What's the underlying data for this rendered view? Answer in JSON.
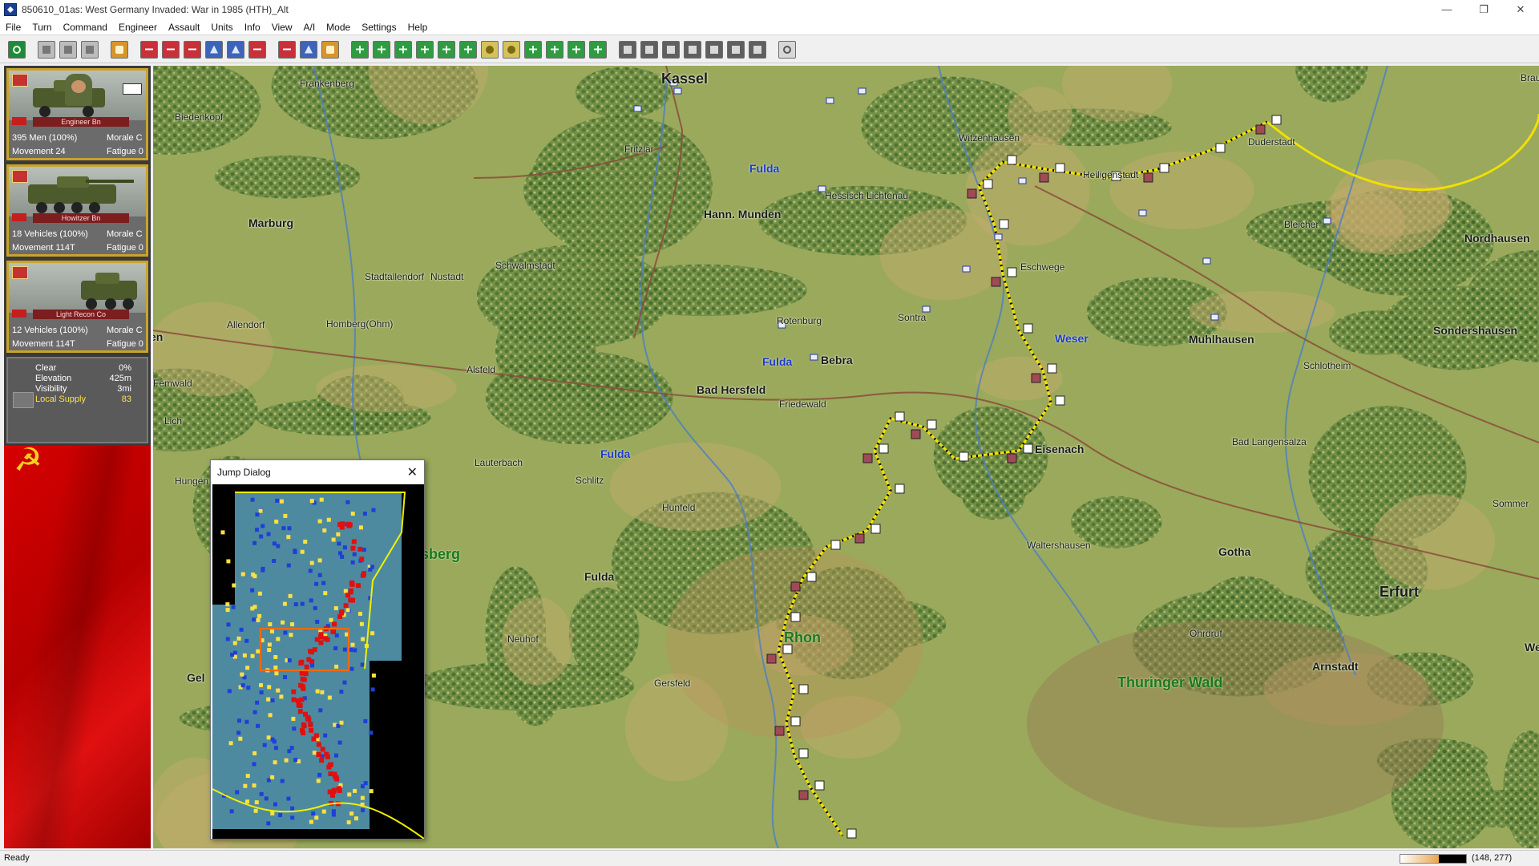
{
  "window": {
    "title": "850610_01as: West Germany Invaded: War in 1985 (HTH)_Alt",
    "minimize": "—",
    "restore": "❐",
    "close": "✕"
  },
  "menu": [
    "File",
    "Turn",
    "Command",
    "Engineer",
    "Assault",
    "Units",
    "Info",
    "View",
    "A/I",
    "Mode",
    "Settings",
    "Help"
  ],
  "toolbar": {
    "buttons": [
      {
        "name": "clock-icon",
        "style": "green"
      },
      {
        "gap": true
      },
      {
        "name": "file-icon",
        "style": "grey"
      },
      {
        "name": "open-icon",
        "style": "grey"
      },
      {
        "name": "save-icon",
        "style": "grey"
      },
      {
        "gap": true
      },
      {
        "name": "supply-icon",
        "style": "orange"
      },
      {
        "gap": true
      },
      {
        "name": "assault-icon",
        "style": "red"
      },
      {
        "name": "defend-icon",
        "style": "red"
      },
      {
        "name": "bombard-icon",
        "style": "red"
      },
      {
        "name": "air-icon",
        "style": "blue"
      },
      {
        "name": "helicopter-icon",
        "style": "blue"
      },
      {
        "name": "list-icon",
        "style": "red"
      },
      {
        "gap": true
      },
      {
        "name": "engineer-icon",
        "style": "red"
      },
      {
        "name": "info-icon",
        "style": "blue"
      },
      {
        "name": "report-icon",
        "style": "orange"
      },
      {
        "gap": true
      },
      {
        "name": "zoom-in-icon",
        "style": "mgreen"
      },
      {
        "name": "zoom-out-icon",
        "style": "mgreen"
      },
      {
        "name": "hex-icon",
        "style": "mgreen"
      },
      {
        "name": "grid-icon",
        "style": "mgreen"
      },
      {
        "name": "terrain-icon",
        "style": "mgreen"
      },
      {
        "name": "flag-icon",
        "style": "mgreen"
      },
      {
        "name": "morale-icon",
        "style": "yellow"
      },
      {
        "name": "fatigue-icon",
        "style": "yellow"
      },
      {
        "name": "road-icon",
        "style": "mgreen"
      },
      {
        "name": "screen-icon",
        "style": "mgreen"
      },
      {
        "name": "map-icon",
        "style": "mgreen"
      },
      {
        "name": "jump-icon",
        "style": "mgreen"
      },
      {
        "gap": true
      },
      {
        "name": "lock-icon",
        "style": "dgrey"
      },
      {
        "name": "vehicle-icon",
        "style": "dgrey"
      },
      {
        "name": "unit-icon",
        "style": "dgrey"
      },
      {
        "name": "stack-icon",
        "style": "dgrey"
      },
      {
        "name": "building-icon",
        "style": "dgrey"
      },
      {
        "name": "hq-icon",
        "style": "dgrey"
      },
      {
        "name": "org-icon",
        "style": "dgrey"
      },
      {
        "gap": true
      },
      {
        "name": "help-icon",
        "style": "help"
      }
    ]
  },
  "units": [
    {
      "type": "Engineer Bn",
      "strength": "395 Men (100%)",
      "morale": "Morale C",
      "movement": "Movement 24",
      "fatigue": "Fatigue 0"
    },
    {
      "type": "Howitzer Bn",
      "strength": "18 Vehicles (100%)",
      "morale": "Morale C",
      "movement": "Movement 114T",
      "fatigue": "Fatigue 0"
    },
    {
      "type": "Light Recon Co",
      "strength": "12 Vehicles (100%)",
      "morale": "Morale C",
      "movement": "Movement 114T",
      "fatigue": "Fatigue 0"
    }
  ],
  "terrain": [
    {
      "label": "Clear",
      "value": "0%"
    },
    {
      "label": "Elevation",
      "value": "425m"
    },
    {
      "label": "Visibility",
      "value": "3mi"
    },
    {
      "label": "Local Supply",
      "value": "83"
    }
  ],
  "flag_emblem": "☭",
  "towns": [
    "Kassel",
    "Frankenberg",
    "Biedenkopf",
    "Fritzlar",
    "Fulda",
    "Witzenhausen",
    "Duderstadt",
    "Braunlage",
    "Heiligenstadt",
    "Hessisch Lichtenau",
    "Hann. Munden",
    "Marburg",
    "Schwalmstadt",
    "Bleicher",
    "Nordhausen",
    "Stadtallendorf",
    "Nustadt",
    "Eschwege",
    "Allendorf",
    "Homberg(Ohm)",
    "Rotenburg",
    "Sontra",
    "Weser",
    "Muhlhausen",
    "Sondershausen",
    "en",
    "Fulda",
    "Bebra",
    "Schlotheim",
    "Alsfeld",
    "Bad Hersfeld",
    "Femwald",
    "Friedewald",
    "Lich",
    "Eisenach",
    "Bad Langensalza",
    "Fulda",
    "Lauterbach",
    "Hungen",
    "Schlitz",
    "Hunfeld",
    "Sommer",
    "Waltershausen",
    "Gotha",
    "sberg",
    "Fulda",
    "Erfurt",
    "Rhon",
    "Weil",
    "Ohrdruf",
    "Neuhof",
    "Arnstadt",
    "Gel",
    "Gersfeld",
    "Thuringer Wald"
  ],
  "jump_dialog": {
    "title": "Jump Dialog",
    "close": "✕"
  },
  "status": {
    "text": "Ready",
    "progress": 0.58,
    "coords": "(148, 277)"
  },
  "colors": {
    "nato_units": "#1e3fd8",
    "pact_units": "#e01010",
    "front_line": "#f0e000",
    "map_base": "#9aa95b",
    "forest": "#4f7a35"
  }
}
